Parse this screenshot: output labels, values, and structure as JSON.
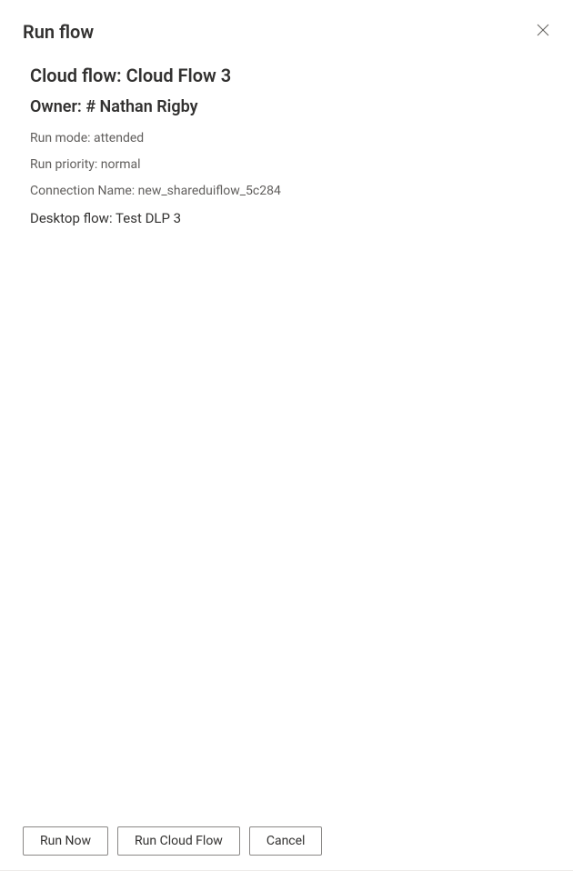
{
  "header": {
    "title": "Run flow"
  },
  "content": {
    "cloud_flow_label": "Cloud flow:",
    "cloud_flow_value": "Cloud Flow 3",
    "owner_label": "Owner:",
    "owner_value": "# Nathan Rigby",
    "run_mode_label": "Run mode:",
    "run_mode_value": "attended",
    "run_priority_label": "Run priority:",
    "run_priority_value": "normal",
    "connection_name_label": "Connection Name:",
    "connection_name_value": "new_shareduiflow_5c284",
    "desktop_flow_label": "Desktop flow:",
    "desktop_flow_value": "Test DLP 3"
  },
  "footer": {
    "run_now_label": "Run Now",
    "run_cloud_flow_label": "Run Cloud Flow",
    "cancel_label": "Cancel"
  }
}
